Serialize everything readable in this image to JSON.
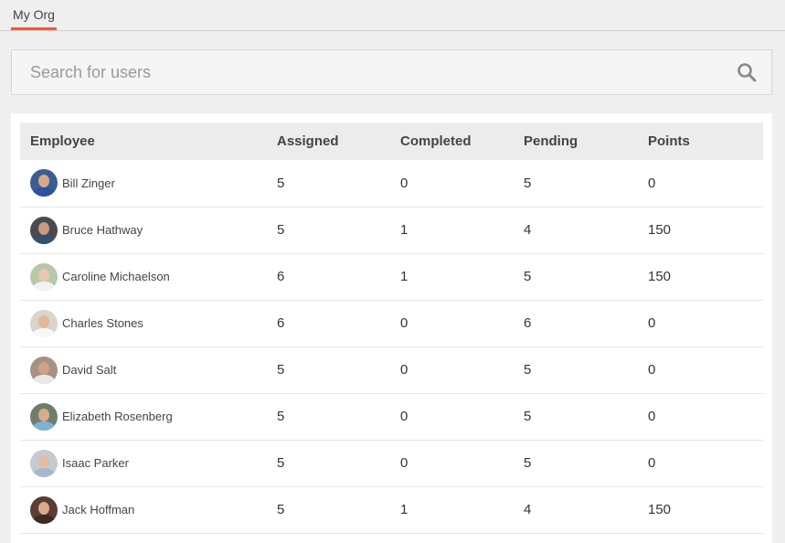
{
  "tabs": [
    {
      "label": "My Org",
      "active": true
    }
  ],
  "accent_color": "#f0583a",
  "search": {
    "placeholder": "Search for users",
    "value": "",
    "icon": "search-icon"
  },
  "table": {
    "columns": [
      "Employee",
      "Assigned",
      "Completed",
      "Pending",
      "Points"
    ],
    "rows": [
      {
        "name": "Bill Zinger",
        "assigned": "5",
        "completed": "0",
        "pending": "5",
        "points": "0",
        "avatar_bg": "#3a5f8f",
        "avatar_face": "#d7a88a",
        "avatar_body": "#2c4f9e"
      },
      {
        "name": "Bruce Hathway",
        "assigned": "5",
        "completed": "1",
        "pending": "4",
        "points": "150",
        "avatar_bg": "#4a4a52",
        "avatar_face": "#c99a7f",
        "avatar_body": "#35506a"
      },
      {
        "name": "Caroline Michaelson",
        "assigned": "6",
        "completed": "1",
        "pending": "5",
        "points": "150",
        "avatar_bg": "#b7c8a8",
        "avatar_face": "#e8c7b2",
        "avatar_body": "#f2f2f2"
      },
      {
        "name": "Charles Stones",
        "assigned": "6",
        "completed": "0",
        "pending": "6",
        "points": "0",
        "avatar_bg": "#d9d4cc",
        "avatar_face": "#e2b69a",
        "avatar_body": "#f7f7f7"
      },
      {
        "name": "David Salt",
        "assigned": "5",
        "completed": "0",
        "pending": "5",
        "points": "0",
        "avatar_bg": "#a49382",
        "avatar_face": "#d2a085",
        "avatar_body": "#e9e9e9"
      },
      {
        "name": "Elizabeth Rosenberg",
        "assigned": "5",
        "completed": "0",
        "pending": "5",
        "points": "0",
        "avatar_bg": "#6d7f6a",
        "avatar_face": "#d9ab8e",
        "avatar_body": "#7fb1d6"
      },
      {
        "name": "Isaac Parker",
        "assigned": "5",
        "completed": "0",
        "pending": "5",
        "points": "0",
        "avatar_bg": "#c6cad0",
        "avatar_face": "#e3bca3",
        "avatar_body": "#a7b6cc"
      },
      {
        "name": "Jack Hoffman",
        "assigned": "5",
        "completed": "1",
        "pending": "4",
        "points": "150",
        "avatar_bg": "#5b3d33",
        "avatar_face": "#d9a98b",
        "avatar_body": "#3b2a26"
      }
    ]
  }
}
